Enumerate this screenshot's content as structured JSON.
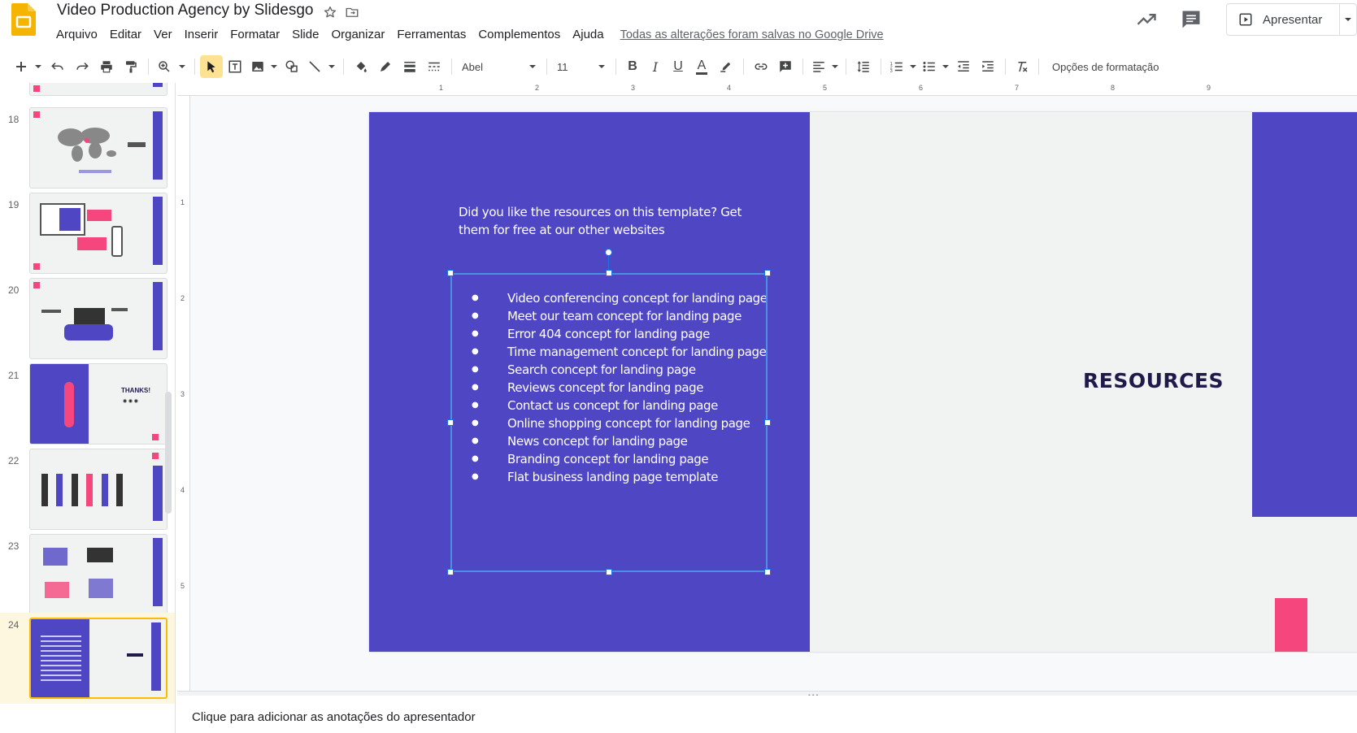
{
  "header": {
    "doc_title": "Video Production Agency by Slidesgo",
    "star_icon": "star-icon",
    "move_icon": "folder-move-icon",
    "save_status": "Todas as alterações foram salvas no Google Drive",
    "present_label": "Apresentar"
  },
  "menu": [
    "Arquivo",
    "Editar",
    "Ver",
    "Inserir",
    "Formatar",
    "Slide",
    "Organizar",
    "Ferramentas",
    "Complementos",
    "Ajuda"
  ],
  "toolbar": {
    "font_name": "Abel",
    "font_size": "11",
    "format_options_label": "Opções de formatação"
  },
  "filmstrip": {
    "slides": [
      {
        "number": "18"
      },
      {
        "number": "19"
      },
      {
        "number": "20"
      },
      {
        "number": "21",
        "thumb_text": "THANKS!"
      },
      {
        "number": "22"
      },
      {
        "number": "23"
      },
      {
        "number": "24",
        "selected": true
      }
    ]
  },
  "ruler": {
    "h_labels": [
      "1",
      "2",
      "3",
      "4",
      "5",
      "6",
      "7",
      "8",
      "9"
    ],
    "v_labels": [
      "1",
      "2",
      "3",
      "4",
      "5"
    ]
  },
  "slide": {
    "intro": "Did you like the resources on this template? Get them for free at our other websites",
    "title": "RESOURCES",
    "bullets": [
      "Video conferencing concept for landing page",
      "Meet our team concept for landing page",
      "Error 404 concept for landing page",
      "Time management concept for landing page",
      "Search concept for landing page",
      "Reviews concept for landing page",
      "Contact us concept for landing page",
      "Online shopping concept for landing page",
      "News concept for landing page",
      "Branding concept for landing page",
      "Flat business landing page template"
    ]
  },
  "notes": {
    "placeholder": "Clique para adicionar as anotações do apresentador"
  },
  "colors": {
    "slide_purple": "#4f46c3",
    "accent_pink": "#f5477d",
    "title_navy": "#1e1b4b",
    "selection_blue": "#1a73e8",
    "selected_thumb_border": "#fbbc04"
  }
}
